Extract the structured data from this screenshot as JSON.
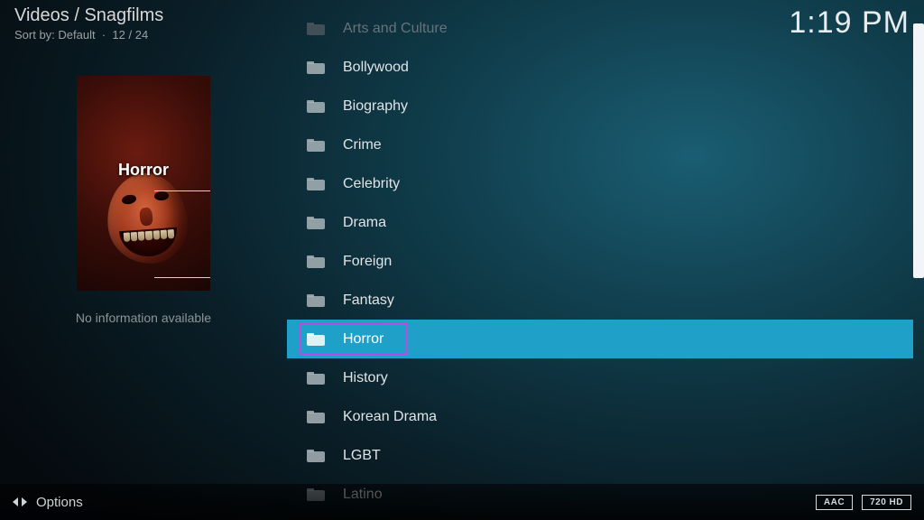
{
  "header": {
    "breadcrumb": "Videos / Snagfilms",
    "sort_label": "Sort by:",
    "sort_value": "Default",
    "position": "12 / 24",
    "clock": "1:19 PM"
  },
  "sidebar": {
    "preview_title": "Horror",
    "info_text": "No information available"
  },
  "list": {
    "items": [
      {
        "label": "Arts and Culture",
        "dim": true,
        "selected": false
      },
      {
        "label": "Bollywood",
        "dim": false,
        "selected": false
      },
      {
        "label": "Biography",
        "dim": false,
        "selected": false
      },
      {
        "label": "Crime",
        "dim": false,
        "selected": false
      },
      {
        "label": "Celebrity",
        "dim": false,
        "selected": false
      },
      {
        "label": "Drama",
        "dim": false,
        "selected": false
      },
      {
        "label": "Foreign",
        "dim": false,
        "selected": false
      },
      {
        "label": "Fantasy",
        "dim": false,
        "selected": false
      },
      {
        "label": "Horror",
        "dim": false,
        "selected": true
      },
      {
        "label": "History",
        "dim": false,
        "selected": false
      },
      {
        "label": "Korean Drama",
        "dim": false,
        "selected": false
      },
      {
        "label": "LGBT",
        "dim": false,
        "selected": false
      },
      {
        "label": "Latino",
        "dim": false,
        "selected": false
      }
    ]
  },
  "bottombar": {
    "options_label": "Options",
    "badges": [
      "AAC",
      "720 HD"
    ]
  }
}
